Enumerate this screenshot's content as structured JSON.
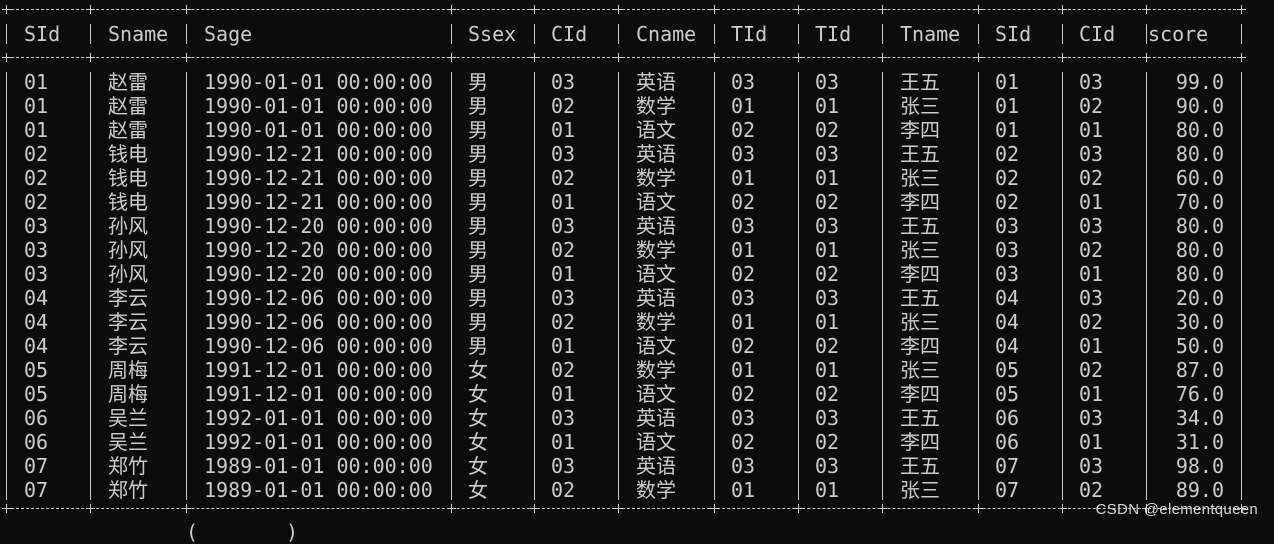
{
  "terminal": {
    "columns": [
      "SId",
      "Sname",
      "Sage",
      "Ssex",
      "CId",
      "Cname",
      "TId",
      "TId",
      "Tname",
      "SId",
      "CId",
      "score"
    ],
    "rows": [
      [
        "01",
        "赵雷",
        "1990-01-01 00:00:00",
        "男",
        "03",
        "英语",
        "03",
        "03",
        "王五",
        "01",
        "03",
        "99.0"
      ],
      [
        "01",
        "赵雷",
        "1990-01-01 00:00:00",
        "男",
        "02",
        "数学",
        "01",
        "01",
        "张三",
        "01",
        "02",
        "90.0"
      ],
      [
        "01",
        "赵雷",
        "1990-01-01 00:00:00",
        "男",
        "01",
        "语文",
        "02",
        "02",
        "李四",
        "01",
        "01",
        "80.0"
      ],
      [
        "02",
        "钱电",
        "1990-12-21 00:00:00",
        "男",
        "03",
        "英语",
        "03",
        "03",
        "王五",
        "02",
        "03",
        "80.0"
      ],
      [
        "02",
        "钱电",
        "1990-12-21 00:00:00",
        "男",
        "02",
        "数学",
        "01",
        "01",
        "张三",
        "02",
        "02",
        "60.0"
      ],
      [
        "02",
        "钱电",
        "1990-12-21 00:00:00",
        "男",
        "01",
        "语文",
        "02",
        "02",
        "李四",
        "02",
        "01",
        "70.0"
      ],
      [
        "03",
        "孙风",
        "1990-12-20 00:00:00",
        "男",
        "03",
        "英语",
        "03",
        "03",
        "王五",
        "03",
        "03",
        "80.0"
      ],
      [
        "03",
        "孙风",
        "1990-12-20 00:00:00",
        "男",
        "02",
        "数学",
        "01",
        "01",
        "张三",
        "03",
        "02",
        "80.0"
      ],
      [
        "03",
        "孙风",
        "1990-12-20 00:00:00",
        "男",
        "01",
        "语文",
        "02",
        "02",
        "李四",
        "03",
        "01",
        "80.0"
      ],
      [
        "04",
        "李云",
        "1990-12-06 00:00:00",
        "男",
        "03",
        "英语",
        "03",
        "03",
        "王五",
        "04",
        "03",
        "20.0"
      ],
      [
        "04",
        "李云",
        "1990-12-06 00:00:00",
        "男",
        "02",
        "数学",
        "01",
        "01",
        "张三",
        "04",
        "02",
        "30.0"
      ],
      [
        "04",
        "李云",
        "1990-12-06 00:00:00",
        "男",
        "01",
        "语文",
        "02",
        "02",
        "李四",
        "04",
        "01",
        "50.0"
      ],
      [
        "05",
        "周梅",
        "1991-12-01 00:00:00",
        "女",
        "02",
        "数学",
        "01",
        "01",
        "张三",
        "05",
        "02",
        "87.0"
      ],
      [
        "05",
        "周梅",
        "1991-12-01 00:00:00",
        "女",
        "01",
        "语文",
        "02",
        "02",
        "李四",
        "05",
        "01",
        "76.0"
      ],
      [
        "06",
        "吴兰",
        "1992-01-01 00:00:00",
        "女",
        "03",
        "英语",
        "03",
        "03",
        "王五",
        "06",
        "03",
        "34.0"
      ],
      [
        "06",
        "吴兰",
        "1992-01-01 00:00:00",
        "女",
        "01",
        "语文",
        "02",
        "02",
        "李四",
        "06",
        "01",
        "31.0"
      ],
      [
        "07",
        "郑竹",
        "1989-01-01 00:00:00",
        "女",
        "03",
        "英语",
        "03",
        "03",
        "王五",
        "07",
        "03",
        "98.0"
      ],
      [
        "07",
        "郑竹",
        "1989-01-01 00:00:00",
        "女",
        "02",
        "数学",
        "01",
        "01",
        "张三",
        "07",
        "02",
        "89.0"
      ]
    ],
    "footer_partial": "(",
    "footer_partial_right": ")"
  },
  "watermark": "CSDN @elementqueen",
  "colors": {
    "background": "#0c0c0c",
    "text": "#cccccc"
  }
}
